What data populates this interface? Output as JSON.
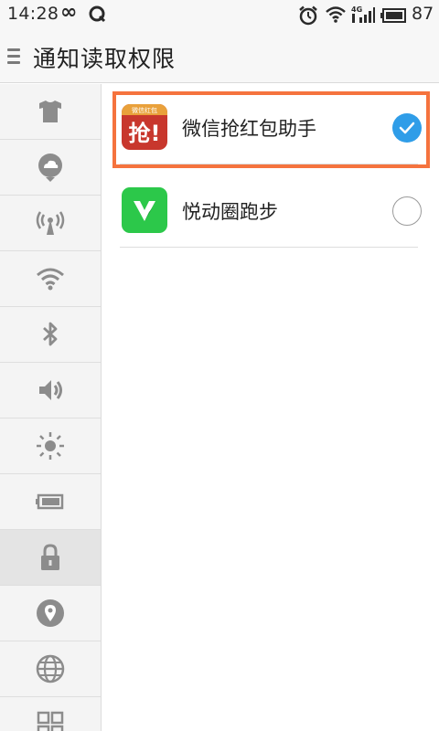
{
  "status_bar": {
    "time": "14:28",
    "infinity_glyph": "∞",
    "network_label": "4G",
    "battery_level": "87"
  },
  "header": {
    "title": "通知读取权限"
  },
  "sidebar": {
    "items": [
      {
        "icon": "tshirt-icon"
      },
      {
        "icon": "cloud-icon"
      },
      {
        "icon": "broadcast-icon"
      },
      {
        "icon": "wifi-icon"
      },
      {
        "icon": "bluetooth-icon"
      },
      {
        "icon": "volume-icon"
      },
      {
        "icon": "brightness-icon"
      },
      {
        "icon": "battery-icon"
      },
      {
        "icon": "lock-icon",
        "active": true
      },
      {
        "icon": "location-icon"
      },
      {
        "icon": "globe-icon"
      },
      {
        "icon": "grid-icon"
      }
    ]
  },
  "apps": [
    {
      "name": "微信抢红包助手",
      "icon_label": "抢!",
      "icon_banner": "微信红包",
      "checked": true
    },
    {
      "name": "悦动圈跑步",
      "checked": false
    }
  ],
  "colors": {
    "accent": "#2f9de8",
    "highlight": "#f5733e",
    "app1_bg": "#c8372d",
    "app2_bg": "#2cc84a"
  }
}
